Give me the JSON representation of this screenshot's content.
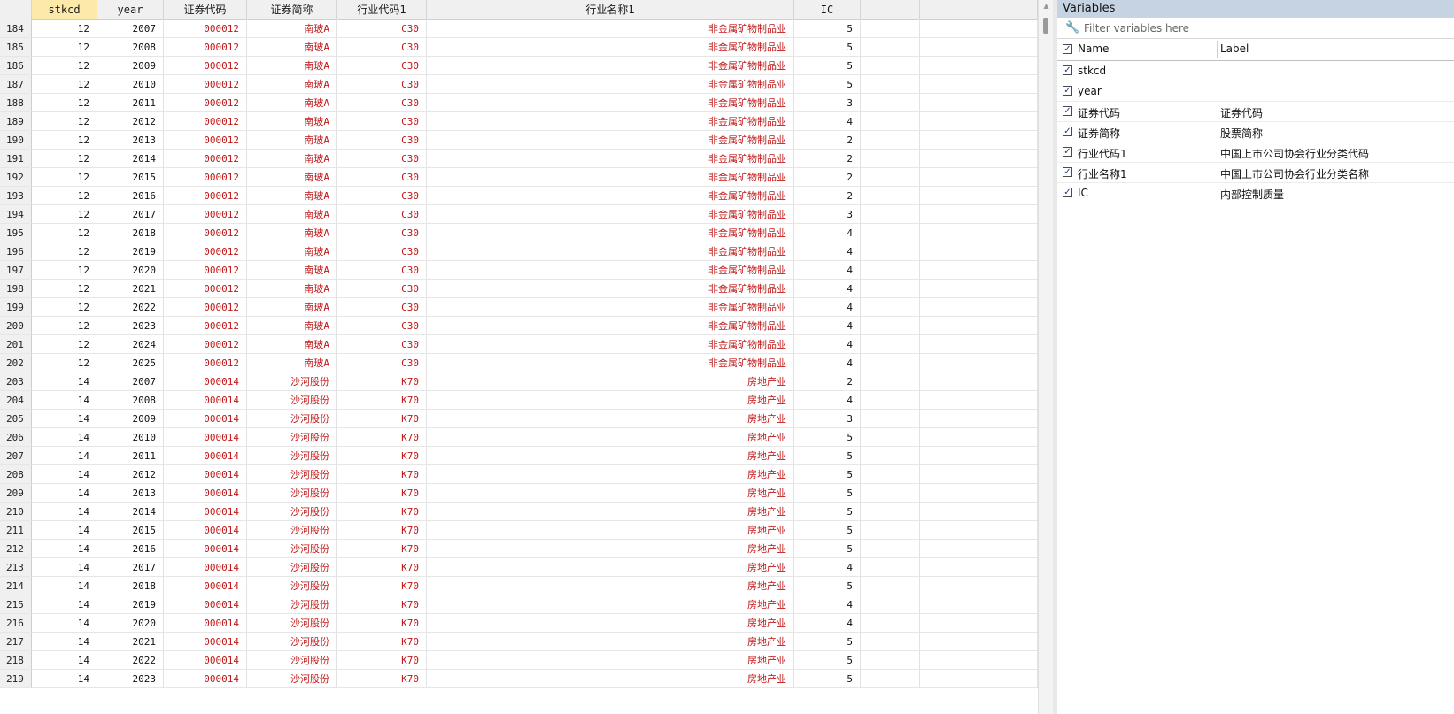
{
  "grid": {
    "columns": [
      {
        "label": "",
        "key": "rownum"
      },
      {
        "label": "stkcd",
        "key": "stkcd",
        "selected": true
      },
      {
        "label": "year",
        "key": "year"
      },
      {
        "label": "证券代码",
        "key": "code"
      },
      {
        "label": "证券简称",
        "key": "abbr"
      },
      {
        "label": "行业代码1",
        "key": "indcode"
      },
      {
        "label": "行业名称1",
        "key": "indname"
      },
      {
        "label": "IC",
        "key": "ic"
      },
      {
        "label": "",
        "key": "blank1"
      },
      {
        "label": "",
        "key": "blank2"
      }
    ],
    "rows": [
      {
        "rownum": "184",
        "stkcd": "12",
        "year": "2007",
        "code": "000012",
        "abbr": "南玻A",
        "indcode": "C30",
        "indname": "非金属矿物制品业",
        "ic": "5"
      },
      {
        "rownum": "185",
        "stkcd": "12",
        "year": "2008",
        "code": "000012",
        "abbr": "南玻A",
        "indcode": "C30",
        "indname": "非金属矿物制品业",
        "ic": "5"
      },
      {
        "rownum": "186",
        "stkcd": "12",
        "year": "2009",
        "code": "000012",
        "abbr": "南玻A",
        "indcode": "C30",
        "indname": "非金属矿物制品业",
        "ic": "5"
      },
      {
        "rownum": "187",
        "stkcd": "12",
        "year": "2010",
        "code": "000012",
        "abbr": "南玻A",
        "indcode": "C30",
        "indname": "非金属矿物制品业",
        "ic": "5"
      },
      {
        "rownum": "188",
        "stkcd": "12",
        "year": "2011",
        "code": "000012",
        "abbr": "南玻A",
        "indcode": "C30",
        "indname": "非金属矿物制品业",
        "ic": "3"
      },
      {
        "rownum": "189",
        "stkcd": "12",
        "year": "2012",
        "code": "000012",
        "abbr": "南玻A",
        "indcode": "C30",
        "indname": "非金属矿物制品业",
        "ic": "4"
      },
      {
        "rownum": "190",
        "stkcd": "12",
        "year": "2013",
        "code": "000012",
        "abbr": "南玻A",
        "indcode": "C30",
        "indname": "非金属矿物制品业",
        "ic": "2"
      },
      {
        "rownum": "191",
        "stkcd": "12",
        "year": "2014",
        "code": "000012",
        "abbr": "南玻A",
        "indcode": "C30",
        "indname": "非金属矿物制品业",
        "ic": "2"
      },
      {
        "rownum": "192",
        "stkcd": "12",
        "year": "2015",
        "code": "000012",
        "abbr": "南玻A",
        "indcode": "C30",
        "indname": "非金属矿物制品业",
        "ic": "2"
      },
      {
        "rownum": "193",
        "stkcd": "12",
        "year": "2016",
        "code": "000012",
        "abbr": "南玻A",
        "indcode": "C30",
        "indname": "非金属矿物制品业",
        "ic": "2"
      },
      {
        "rownum": "194",
        "stkcd": "12",
        "year": "2017",
        "code": "000012",
        "abbr": "南玻A",
        "indcode": "C30",
        "indname": "非金属矿物制品业",
        "ic": "3"
      },
      {
        "rownum": "195",
        "stkcd": "12",
        "year": "2018",
        "code": "000012",
        "abbr": "南玻A",
        "indcode": "C30",
        "indname": "非金属矿物制品业",
        "ic": "4"
      },
      {
        "rownum": "196",
        "stkcd": "12",
        "year": "2019",
        "code": "000012",
        "abbr": "南玻A",
        "indcode": "C30",
        "indname": "非金属矿物制品业",
        "ic": "4"
      },
      {
        "rownum": "197",
        "stkcd": "12",
        "year": "2020",
        "code": "000012",
        "abbr": "南玻A",
        "indcode": "C30",
        "indname": "非金属矿物制品业",
        "ic": "4"
      },
      {
        "rownum": "198",
        "stkcd": "12",
        "year": "2021",
        "code": "000012",
        "abbr": "南玻A",
        "indcode": "C30",
        "indname": "非金属矿物制品业",
        "ic": "4"
      },
      {
        "rownum": "199",
        "stkcd": "12",
        "year": "2022",
        "code": "000012",
        "abbr": "南玻A",
        "indcode": "C30",
        "indname": "非金属矿物制品业",
        "ic": "4"
      },
      {
        "rownum": "200",
        "stkcd": "12",
        "year": "2023",
        "code": "000012",
        "abbr": "南玻A",
        "indcode": "C30",
        "indname": "非金属矿物制品业",
        "ic": "4"
      },
      {
        "rownum": "201",
        "stkcd": "12",
        "year": "2024",
        "code": "000012",
        "abbr": "南玻A",
        "indcode": "C30",
        "indname": "非金属矿物制品业",
        "ic": "4"
      },
      {
        "rownum": "202",
        "stkcd": "12",
        "year": "2025",
        "code": "000012",
        "abbr": "南玻A",
        "indcode": "C30",
        "indname": "非金属矿物制品业",
        "ic": "4"
      },
      {
        "rownum": "203",
        "stkcd": "14",
        "year": "2007",
        "code": "000014",
        "abbr": "沙河股份",
        "indcode": "K70",
        "indname": "房地产业",
        "ic": "2"
      },
      {
        "rownum": "204",
        "stkcd": "14",
        "year": "2008",
        "code": "000014",
        "abbr": "沙河股份",
        "indcode": "K70",
        "indname": "房地产业",
        "ic": "4"
      },
      {
        "rownum": "205",
        "stkcd": "14",
        "year": "2009",
        "code": "000014",
        "abbr": "沙河股份",
        "indcode": "K70",
        "indname": "房地产业",
        "ic": "3"
      },
      {
        "rownum": "206",
        "stkcd": "14",
        "year": "2010",
        "code": "000014",
        "abbr": "沙河股份",
        "indcode": "K70",
        "indname": "房地产业",
        "ic": "5"
      },
      {
        "rownum": "207",
        "stkcd": "14",
        "year": "2011",
        "code": "000014",
        "abbr": "沙河股份",
        "indcode": "K70",
        "indname": "房地产业",
        "ic": "5"
      },
      {
        "rownum": "208",
        "stkcd": "14",
        "year": "2012",
        "code": "000014",
        "abbr": "沙河股份",
        "indcode": "K70",
        "indname": "房地产业",
        "ic": "5"
      },
      {
        "rownum": "209",
        "stkcd": "14",
        "year": "2013",
        "code": "000014",
        "abbr": "沙河股份",
        "indcode": "K70",
        "indname": "房地产业",
        "ic": "5"
      },
      {
        "rownum": "210",
        "stkcd": "14",
        "year": "2014",
        "code": "000014",
        "abbr": "沙河股份",
        "indcode": "K70",
        "indname": "房地产业",
        "ic": "5"
      },
      {
        "rownum": "211",
        "stkcd": "14",
        "year": "2015",
        "code": "000014",
        "abbr": "沙河股份",
        "indcode": "K70",
        "indname": "房地产业",
        "ic": "5"
      },
      {
        "rownum": "212",
        "stkcd": "14",
        "year": "2016",
        "code": "000014",
        "abbr": "沙河股份",
        "indcode": "K70",
        "indname": "房地产业",
        "ic": "5"
      },
      {
        "rownum": "213",
        "stkcd": "14",
        "year": "2017",
        "code": "000014",
        "abbr": "沙河股份",
        "indcode": "K70",
        "indname": "房地产业",
        "ic": "4"
      },
      {
        "rownum": "214",
        "stkcd": "14",
        "year": "2018",
        "code": "000014",
        "abbr": "沙河股份",
        "indcode": "K70",
        "indname": "房地产业",
        "ic": "5"
      },
      {
        "rownum": "215",
        "stkcd": "14",
        "year": "2019",
        "code": "000014",
        "abbr": "沙河股份",
        "indcode": "K70",
        "indname": "房地产业",
        "ic": "4"
      },
      {
        "rownum": "216",
        "stkcd": "14",
        "year": "2020",
        "code": "000014",
        "abbr": "沙河股份",
        "indcode": "K70",
        "indname": "房地产业",
        "ic": "4"
      },
      {
        "rownum": "217",
        "stkcd": "14",
        "year": "2021",
        "code": "000014",
        "abbr": "沙河股份",
        "indcode": "K70",
        "indname": "房地产业",
        "ic": "5"
      },
      {
        "rownum": "218",
        "stkcd": "14",
        "year": "2022",
        "code": "000014",
        "abbr": "沙河股份",
        "indcode": "K70",
        "indname": "房地产业",
        "ic": "5"
      },
      {
        "rownum": "219",
        "stkcd": "14",
        "year": "2023",
        "code": "000014",
        "abbr": "沙河股份",
        "indcode": "K70",
        "indname": "房地产业",
        "ic": "5"
      }
    ]
  },
  "variables": {
    "title": "Variables",
    "filter_placeholder": "Filter variables here",
    "col_name": "Name",
    "col_label": "Label",
    "items": [
      {
        "name": "stkcd",
        "label": ""
      },
      {
        "name": "year",
        "label": ""
      },
      {
        "name": "证券代码",
        "label": "证券代码"
      },
      {
        "name": "证券简称",
        "label": "股票简称"
      },
      {
        "name": "行业代码1",
        "label": "中国上市公司协会行业分类代码"
      },
      {
        "name": "行业名称1",
        "label": "中国上市公司协会行业分类名称"
      },
      {
        "name": "IC",
        "label": "内部控制质量"
      }
    ]
  },
  "colors": {
    "string_text": "#c01818",
    "numeric_text": "#111111",
    "selected_header": "#fde9a9",
    "panel_title_bg": "#c5d3e2"
  }
}
